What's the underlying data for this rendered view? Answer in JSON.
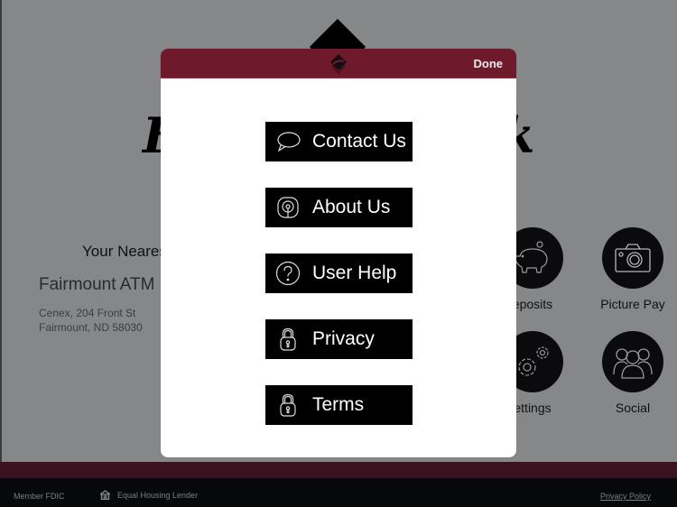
{
  "background": {
    "title_left": "F",
    "title_right": "k",
    "nearest_label": "Your Neares",
    "atm": {
      "name": "Fairmount ATM",
      "address_line1": "Cenex, 204 Front St",
      "address_line2": "Fairmount, ND 58030"
    },
    "tiles": [
      {
        "label": "eposits",
        "icon": "piggy-bank-icon"
      },
      {
        "label": "Picture Pay",
        "icon": "camera-icon"
      },
      {
        "label": "ettings",
        "icon": "gears-icon"
      },
      {
        "label": "Social",
        "icon": "people-icon"
      }
    ]
  },
  "modal": {
    "header_color": "#6e1a2c",
    "done_label": "Done",
    "menu": [
      {
        "label": "Contact Us",
        "icon": "speech-bubble-icon"
      },
      {
        "label": "About Us",
        "icon": "info-badge-icon"
      },
      {
        "label": "User Help",
        "icon": "question-circle-icon"
      },
      {
        "label": "Privacy",
        "icon": "padlock-icon"
      },
      {
        "label": "Terms",
        "icon": "padlock-icon"
      }
    ]
  },
  "footer": {
    "member_fdic": "Member FDIC",
    "equal_housing": "Equal Housing Lender",
    "privacy_policy": "Privacy Policy"
  }
}
